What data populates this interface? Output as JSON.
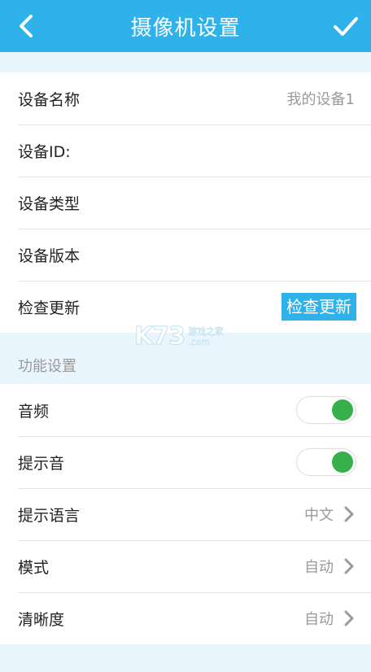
{
  "header": {
    "title": "摄像机设置",
    "back_icon": "chevron-left-icon",
    "confirm_icon": "check-icon",
    "bg_color": "#2fb1ea"
  },
  "device": {
    "name_label": "设备名称",
    "name_value": "我的设备1",
    "id_label": "设备ID:",
    "type_label": "设备类型",
    "version_label": "设备版本",
    "update_label": "检查更新",
    "update_button": "检查更新"
  },
  "features": {
    "section_title": "功能设置",
    "audio_label": "音频",
    "audio_on": true,
    "prompt_sound_label": "提示音",
    "prompt_sound_on": true,
    "language_label": "提示语言",
    "language_value": "中文",
    "mode_label": "模式",
    "mode_value": "自动",
    "clarity_label": "清晰度",
    "clarity_value": "自动"
  },
  "watermark": {
    "logo": "K73",
    "line1": "游戏之家",
    "line2": ".com"
  },
  "colors": {
    "accent": "#2fb1ea",
    "toggle_on": "#35b04b",
    "page_bg": "#e9f5fc"
  }
}
